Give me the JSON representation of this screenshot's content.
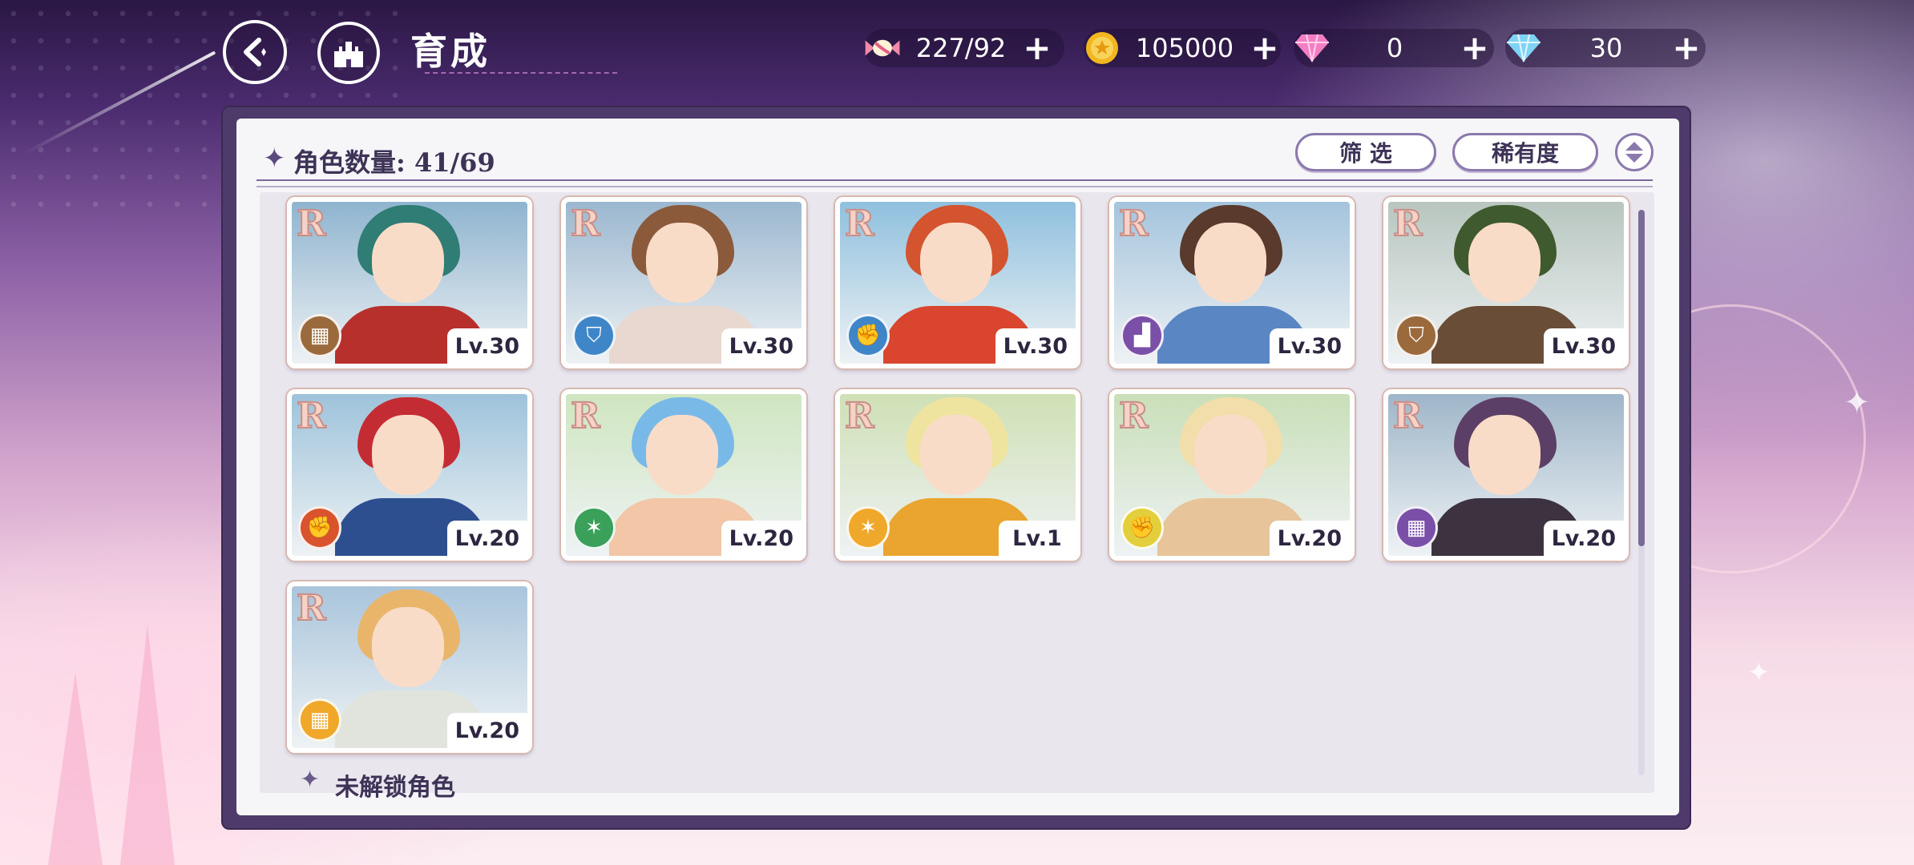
{
  "header": {
    "title": "育成",
    "back_icon": "back-icon",
    "home_icon": "castle-icon"
  },
  "resources": [
    {
      "name": "stamina",
      "icon": "candy-icon",
      "value": "227/92",
      "plus": "+"
    },
    {
      "name": "gold",
      "icon": "coin-icon",
      "value": "105000",
      "plus": "+"
    },
    {
      "name": "gem-pink",
      "icon": "pink-diamond-icon",
      "value": "0",
      "plus": "+"
    },
    {
      "name": "gem-blue",
      "icon": "blue-diamond-icon",
      "value": "30",
      "plus": "+"
    }
  ],
  "panel": {
    "count_star": "✦",
    "count_label": "角色数量: 41/69",
    "filter_label": "筛 选",
    "rarity_label": "稀有度",
    "sort_icon": "sort-up-down-icon",
    "locked_star": "✦",
    "locked_label": "未解锁角色"
  },
  "characters": [
    {
      "rarity": "R",
      "level": "Lv.30",
      "role_color": "#9b6a3c",
      "role_icon": "card-icon",
      "hair": "#2f7d74",
      "outfit": "#b7302c",
      "bg": "#8fb4cf"
    },
    {
      "rarity": "R",
      "level": "Lv.30",
      "role_color": "#3f86c8",
      "role_icon": "shield-icon",
      "hair": "#8a5a3b",
      "outfit": "#e9d8d0",
      "bg": "#9bb7cf"
    },
    {
      "rarity": "R",
      "level": "Lv.30",
      "role_color": "#3f86c8",
      "role_icon": "fist-icon",
      "hair": "#d3542e",
      "outfit": "#d9452e",
      "bg": "#8fc0de"
    },
    {
      "rarity": "R",
      "level": "Lv.30",
      "role_color": "#7a4fa8",
      "role_icon": "boot-icon",
      "hair": "#5a3a2c",
      "outfit": "#5b86c4",
      "bg": "#a4c4dd"
    },
    {
      "rarity": "R",
      "level": "Lv.30",
      "role_color": "#9b6a3c",
      "role_icon": "shield-icon",
      "hair": "#3f5a2e",
      "outfit": "#6a4d37",
      "bg": "#b8c6bf"
    },
    {
      "rarity": "R",
      "level": "Lv.20",
      "role_color": "#d9532c",
      "role_icon": "fist-icon",
      "hair": "#c42c33",
      "outfit": "#2d4f8f",
      "bg": "#9ec3db"
    },
    {
      "rarity": "R",
      "level": "Lv.20",
      "role_color": "#3aa05a",
      "role_icon": "wand-icon",
      "hair": "#79b9e8",
      "outfit": "#f2c6a6",
      "bg": "#cfe6c0"
    },
    {
      "rarity": "R",
      "level": "Lv.1",
      "role_color": "#f0a82a",
      "role_icon": "wand-icon",
      "hair": "#efe3a0",
      "outfit": "#e9a52f",
      "bg": "#cfe0b5"
    },
    {
      "rarity": "R",
      "level": "Lv.20",
      "role_color": "#e3cf3b",
      "role_icon": "fist-icon",
      "hair": "#f1deaa",
      "outfit": "#e7c49a",
      "bg": "#c9dfb8"
    },
    {
      "rarity": "R",
      "level": "Lv.20",
      "role_color": "#7a4fa8",
      "role_icon": "card-icon",
      "hair": "#5c3f66",
      "outfit": "#3d3340",
      "bg": "#9fb6c9"
    },
    {
      "rarity": "R",
      "level": "Lv.20",
      "role_color": "#f0a82a",
      "role_icon": "card-icon",
      "hair": "#e9b56b",
      "outfit": "#e0e4dc",
      "bg": "#a9c5dc"
    }
  ]
}
